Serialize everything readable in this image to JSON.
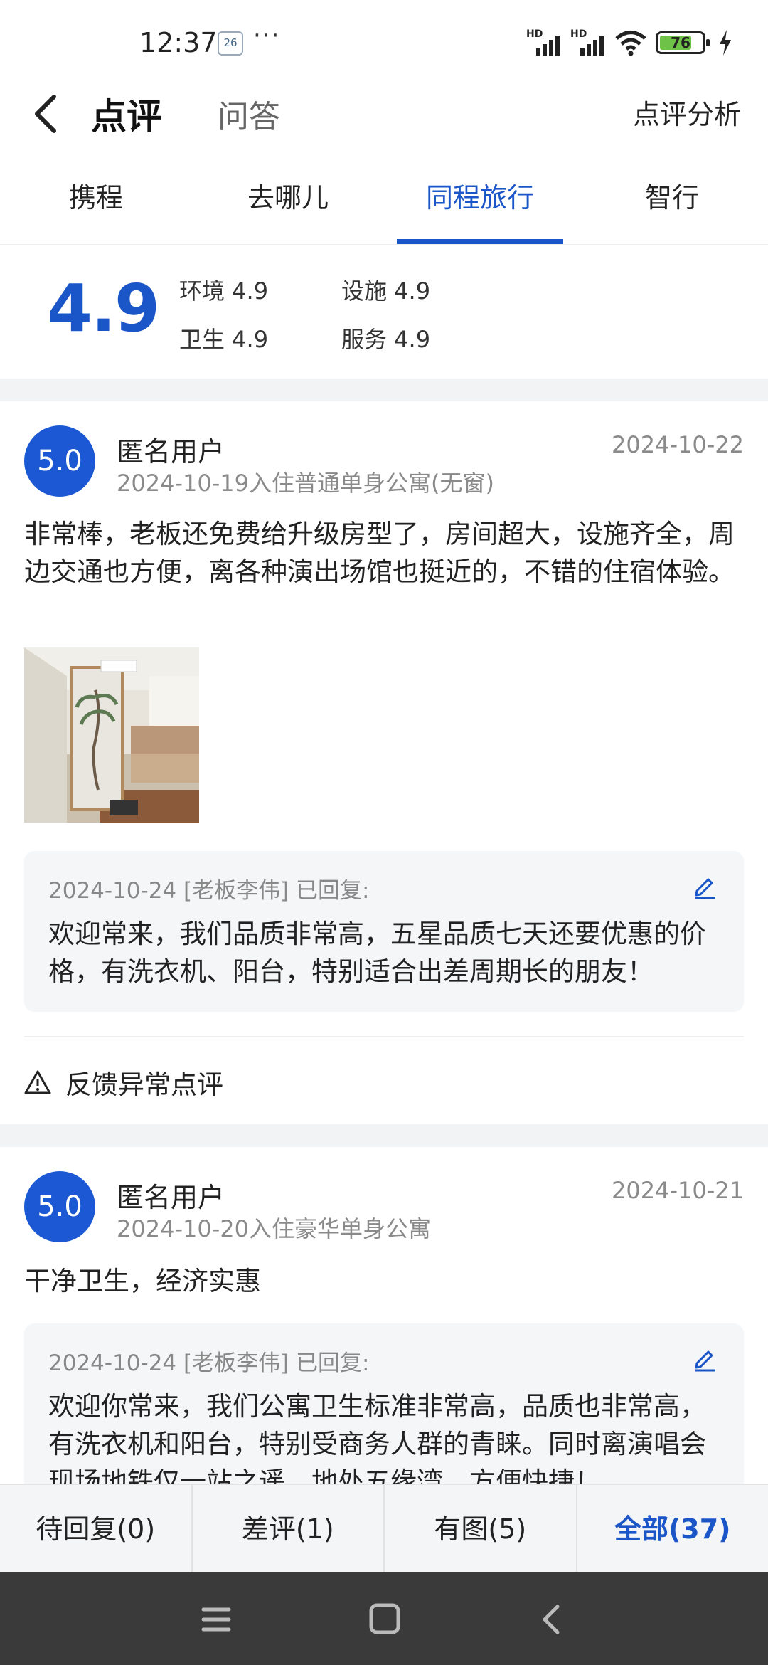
{
  "status": {
    "time": "12:37",
    "notification": "26",
    "more": "···",
    "signal1": "HD",
    "signal2": "HD",
    "battery": "76",
    "battery_level": 0.76
  },
  "header": {
    "title": "点评",
    "qa_tab": "问答",
    "analysis": "点评分析"
  },
  "platform_tabs": [
    {
      "label": "携程",
      "active": false
    },
    {
      "label": "去哪儿",
      "active": false
    },
    {
      "label": "同程旅行",
      "active": true
    },
    {
      "label": "智行",
      "active": false
    }
  ],
  "ratings": {
    "overall": "4.9",
    "environment": "环境 4.9",
    "facilities": "设施 4.9",
    "hygiene": "卫生 4.9",
    "service": "服务 4.9"
  },
  "reviews": [
    {
      "score": "5.0",
      "user": "匿名用户",
      "stay": "2024-10-19入住普通单身公寓(无窗)",
      "date": "2024-10-22",
      "content": "非常棒，老板还免费给升级房型了，房间超大，设施齐全，周边交通也方便，离各种演出场馆也挺近的，不错的住宿体验。",
      "reply_head": "2024-10-24 [老板李伟] 已回复:",
      "reply_text": "欢迎常来，我们品质非常高，五星品质七天还要优惠的价格，有洗衣机、阳台，特别适合出差周期长的朋友！",
      "feedback": "反馈异常点评"
    },
    {
      "score": "5.0",
      "user": "匿名用户",
      "stay": "2024-10-20入住豪华单身公寓",
      "date": "2024-10-21",
      "content": "干净卫生，经济实惠",
      "reply_head": "2024-10-24 [老板李伟] 已回复:",
      "reply_text": "欢迎你常来，我们公寓卫生标准非常高，品质也非常高，有洗衣机和阳台，特别受商务人群的青睐。同时离演唱会现场地铁仅一站之遥，地处五缘湾，方便快捷！"
    }
  ],
  "filters": [
    {
      "label": "待回复(0)",
      "active": false
    },
    {
      "label": "差评(1)",
      "active": false
    },
    {
      "label": "有图(5)",
      "active": false
    },
    {
      "label": "全部(37)",
      "active": true
    }
  ],
  "colors": {
    "accent": "#1a56c8",
    "badge": "#1c58d4",
    "battery_fill": "#6ec247"
  },
  "icons": [
    "back-icon",
    "edit-icon",
    "warning-icon",
    "menu-icon",
    "home-icon",
    "nav-back-icon"
  ]
}
